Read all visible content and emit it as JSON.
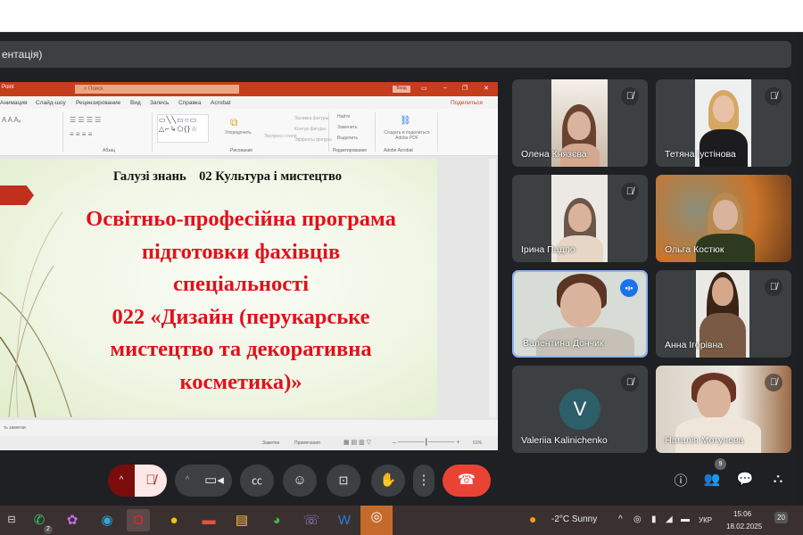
{
  "meeting": {
    "presentation_title": "ентація)"
  },
  "powerpoint": {
    "app_name": "Point",
    "search_placeholder": "Поиск",
    "sign_in": "Вход",
    "tabs": [
      "Анимация",
      "Слайд-шоу",
      "Рецензирование",
      "Вид",
      "Запись",
      "Справка",
      "Acrobat"
    ],
    "share": "Поделиться",
    "ribbon": {
      "groups": [
        "Абзац",
        "Рисование",
        "Редактирование",
        "Adobe Acrobat"
      ],
      "items": [
        "Упорядочить",
        "Экспресс-стили",
        "Заливка фигуры",
        "Контур фигуры",
        "Эффекты фигуры",
        "Найти",
        "Заменить",
        "Выделить",
        "Создать и поделиться Adobe PDF"
      ]
    },
    "notes_label": "ть заметки",
    "status": {
      "notes": "Заметки",
      "comments": "Примечания",
      "zoom": "61%"
    }
  },
  "slide": {
    "header": "Галузі знань    02 Культура і мистецтво",
    "title_lines": [
      "Освітньо-професійна програма",
      "підготовки фахівців",
      "спеціальності",
      "022 «Дизайн (перукарське",
      "мистецтво та декоративна",
      "косметика)»"
    ],
    "accent_color": "#e3101a"
  },
  "participants": [
    {
      "name": "Олена Князєва",
      "muted": true
    },
    {
      "name": "Тетяна Іустінова",
      "muted": true
    },
    {
      "name": "Ірина Падло",
      "muted": true
    },
    {
      "name": "Ольга Костюк",
      "muted": false
    },
    {
      "name": "Валентина Дончик",
      "muted": false,
      "speaking": true
    },
    {
      "name": "Анна Ігорівна",
      "muted": true
    },
    {
      "name": "Valeriia Kalinichenko",
      "muted": true,
      "initial": "V"
    },
    {
      "name": "Наталія Мотунова",
      "muted": true
    }
  ],
  "controls": {
    "mic": "mic-off-icon",
    "camera": "camera-icon",
    "captions": "captions-icon",
    "emoji": "emoji-icon",
    "present": "present-icon",
    "raise_hand": "hand-icon",
    "more": "more-icon",
    "leave": "hang-up-icon",
    "people_count": "9",
    "end_call_color": "#ea4335"
  },
  "taskbar": {
    "whatsapp_badge": "2",
    "weather": "-2°C  Sunny",
    "language": "УКР",
    "time": "15:06",
    "date": "18.02.2025",
    "notifications": "20"
  }
}
